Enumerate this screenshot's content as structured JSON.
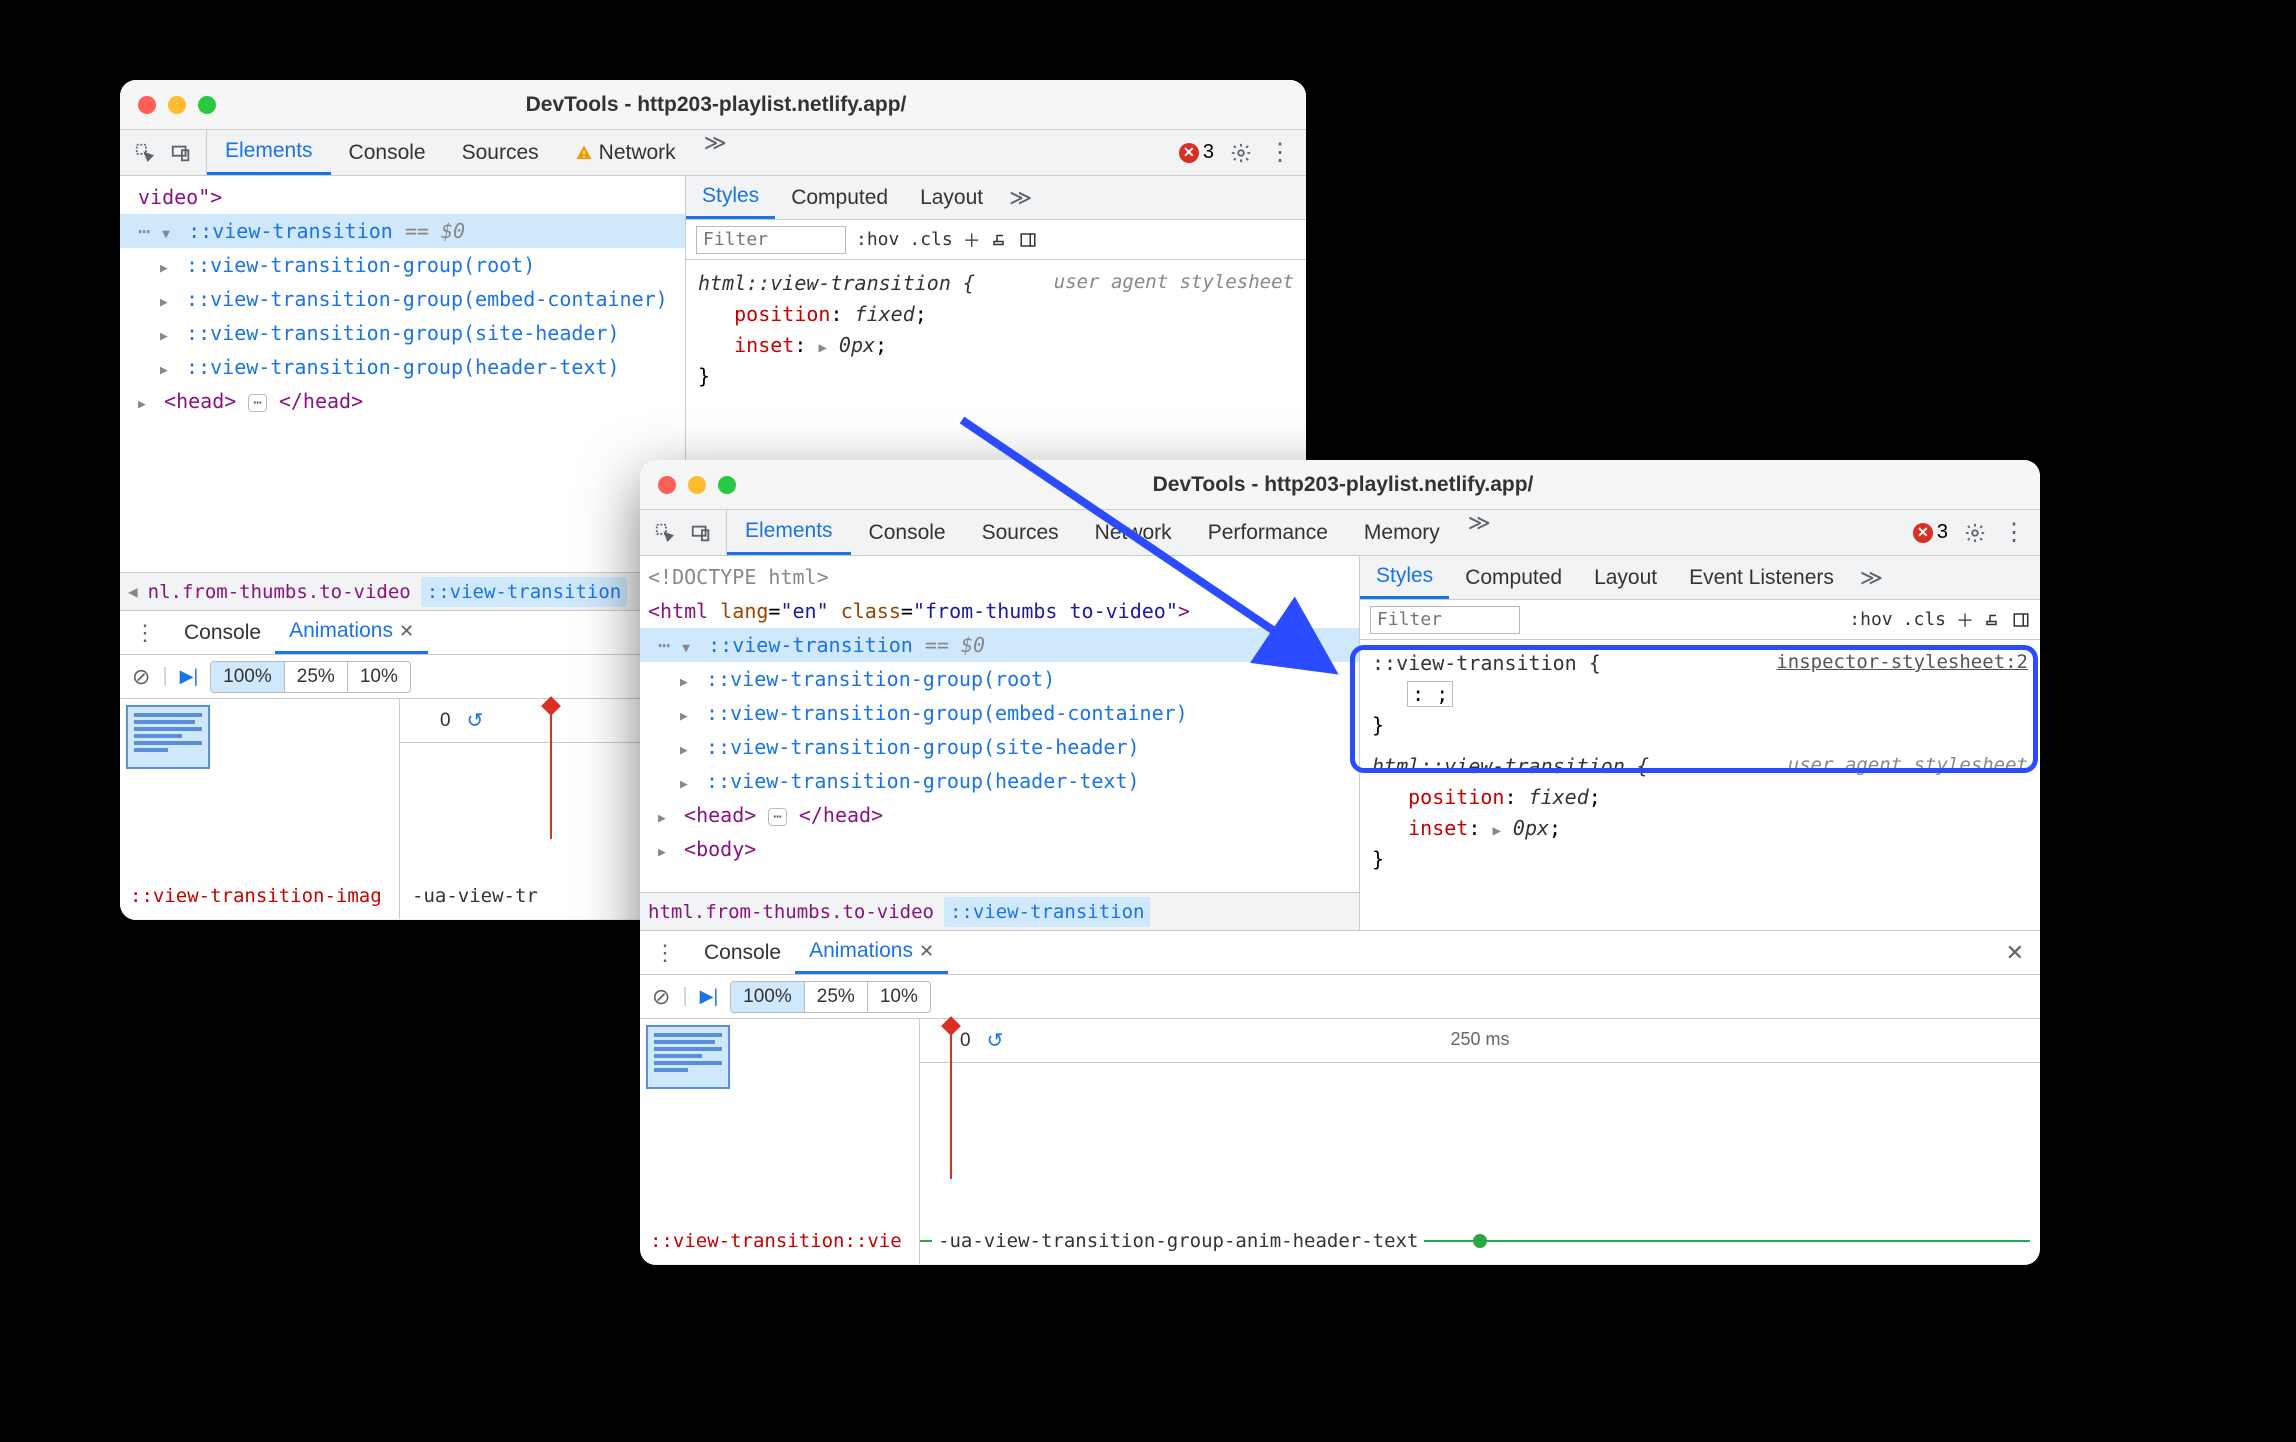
{
  "windowA": {
    "title": "DevTools - http203-playlist.netlify.app/",
    "tabs": [
      "Elements",
      "Console",
      "Sources",
      "Network"
    ],
    "activeTab": "Elements",
    "networkWarning": true,
    "errorCount": "3",
    "dom": {
      "line0": "video\">",
      "line1_pseudo": "::view-transition",
      "line1_eq": " == $0",
      "group_root": "::view-transition-group(root)",
      "group_embed": "::view-transition-group(embed-container)",
      "group_site": "::view-transition-group(site-header)",
      "group_header": "::view-transition-group(header-text)",
      "head_open": "<head>",
      "head_close": "</head>"
    },
    "breadcrumb": {
      "item1": "nl.from-thumbs.to-video",
      "item2": "::view-transition"
    },
    "styles": {
      "tabs": [
        "Styles",
        "Computed",
        "Layout"
      ],
      "activeTab": "Styles",
      "filterPlaceholder": "Filter",
      "hov": ":hov",
      "cls": ".cls",
      "rule1_sel": "html::view-transition {",
      "rule1_src": "user agent stylesheet",
      "rule1_p1n": "position",
      "rule1_p1v": "fixed",
      "rule1_p2n": "inset",
      "rule1_p2v": "0px"
    },
    "drawer": {
      "tabs": [
        "Console",
        "Animations"
      ],
      "activeTab": "Animations",
      "speeds": [
        "100%",
        "25%",
        "10%"
      ],
      "activeSpeed": "100%",
      "ruler_zero": "0",
      "trackLeft": "::view-transition-imag",
      "trackRight": "-ua-view-tr"
    }
  },
  "windowB": {
    "title": "DevTools - http203-playlist.netlify.app/",
    "tabs": [
      "Elements",
      "Console",
      "Sources",
      "Network",
      "Performance",
      "Memory"
    ],
    "activeTab": "Elements",
    "errorCount": "3",
    "dom": {
      "doctype": "<!DOCTYPE html>",
      "html_open_pre": "<html ",
      "html_lang_n": "lang",
      "html_lang_v": "\"en\"",
      "html_class_n": "class",
      "html_class_v": "\"from-thumbs to-video\"",
      "html_open_post": ">",
      "vt_pseudo": "::view-transition",
      "vt_eq": " == $0",
      "g_root": "::view-transition-group(root)",
      "g_embed": "::view-transition-group(embed-container)",
      "g_site": "::view-transition-group(site-header)",
      "g_header": "::view-transition-group(header-text)",
      "head_open": "<head>",
      "head_close": "</head>",
      "body_open": "<body>"
    },
    "breadcrumb": {
      "item1": "html.from-thumbs.to-video",
      "item2": "::view-transition"
    },
    "styles": {
      "tabs": [
        "Styles",
        "Computed",
        "Layout",
        "Event Listeners"
      ],
      "activeTab": "Styles",
      "filterPlaceholder": "Filter",
      "hov": ":hov",
      "cls": ".cls",
      "new_sel": "::view-transition {",
      "new_src": "inspector-stylesheet:2",
      "new_editing": ": ;",
      "close_brace": "}",
      "rule_sel": "html::view-transition {",
      "rule_src": "user agent stylesheet",
      "rule_p1n": "position",
      "rule_p1v": "fixed",
      "rule_p2n": "inset",
      "rule_p2v": "0px"
    },
    "drawer": {
      "tabs": [
        "Console",
        "Animations"
      ],
      "activeTab": "Animations",
      "speeds": [
        "100%",
        "25%",
        "10%"
      ],
      "activeSpeed": "100%",
      "ruler_zero": "0",
      "tick_250": "250 ms",
      "trackLeft": "::view-transition::vie",
      "trackRight": "-ua-view-transition-group-anim-header-text"
    }
  }
}
